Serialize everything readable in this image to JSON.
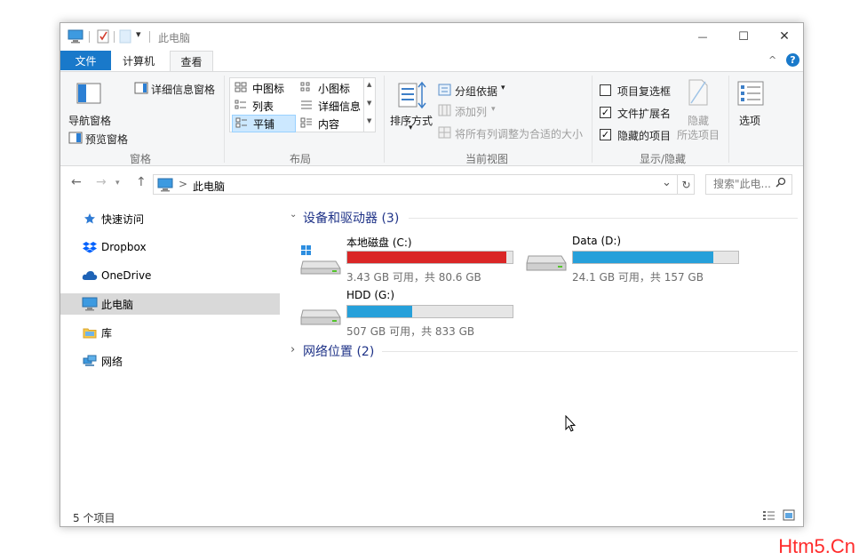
{
  "window": {
    "title": "此电脑",
    "min_glyph": "—",
    "max_glyph": "☐",
    "close_glyph": "✕"
  },
  "quick_access": {
    "dropdown_glyph": "▾"
  },
  "ribbon_tabs": {
    "file": "文件",
    "computer": "计算机",
    "view": "查看",
    "help_glyph": "?",
    "collapse_glyph": "^"
  },
  "ribbon": {
    "panes_group": {
      "label": "窗格",
      "nav_pane": "导航窗格",
      "preview_pane": "预览窗格",
      "details_pane": "详细信息窗格"
    },
    "layout_group": {
      "label": "布局",
      "items": [
        "中图标",
        "小图标",
        "列表",
        "详细信息",
        "平铺",
        "内容"
      ],
      "selected": "平铺"
    },
    "current_view_group": {
      "label": "当前视图",
      "sort_by": "排序方式",
      "group_by": "分组依据",
      "add_columns": "添加列",
      "fit_columns": "将所有列调整为合适的大小"
    },
    "show_hide_group": {
      "label": "显示/隐藏",
      "item_checkboxes": {
        "label": "项目复选框",
        "checked": false
      },
      "file_extensions": {
        "label": "文件扩展名",
        "checked": true
      },
      "hidden_items": {
        "label": "隐藏的项目",
        "checked": true
      },
      "hide_selected": "隐藏",
      "hide_selected_2": "所选项目"
    },
    "options": "选项"
  },
  "address_bar": {
    "path": "此电脑",
    "separator": ">",
    "search_placeholder": "搜索\"此电...",
    "back_glyph": "←",
    "forward_glyph": "→",
    "up_glyph": "↑",
    "dropdown_glyph": "⌄",
    "refresh_glyph": "↻"
  },
  "nav_pane": {
    "items": [
      {
        "label": "快速访问",
        "icon": "star-icon"
      },
      {
        "label": "Dropbox",
        "icon": "dropbox-icon"
      },
      {
        "label": "OneDrive",
        "icon": "cloud-icon"
      },
      {
        "label": "此电脑",
        "icon": "computer-icon",
        "selected": true
      },
      {
        "label": "库",
        "icon": "library-icon"
      },
      {
        "label": "网络",
        "icon": "network-icon"
      }
    ]
  },
  "content": {
    "devices_section": {
      "title": "设备和驱动器 (3)",
      "expanded": true
    },
    "network_section": {
      "title": "网络位置 (2)",
      "expanded": false
    },
    "drives": [
      {
        "name": "本地磁盘 (C:)",
        "info": "3.43 GB 可用，共 80.6 GB",
        "used_fraction": 0.96,
        "color": "#da2626"
      },
      {
        "name": "Data (D:)",
        "info": "24.1 GB 可用，共 157 GB",
        "used_fraction": 0.85,
        "color": "#26a0da"
      },
      {
        "name": "HDD (G:)",
        "info": "507 GB 可用，共 833 GB",
        "used_fraction": 0.39,
        "color": "#26a0da"
      }
    ]
  },
  "status_bar": {
    "item_count": "5 个项目"
  },
  "watermark": "Htm5.Cn"
}
